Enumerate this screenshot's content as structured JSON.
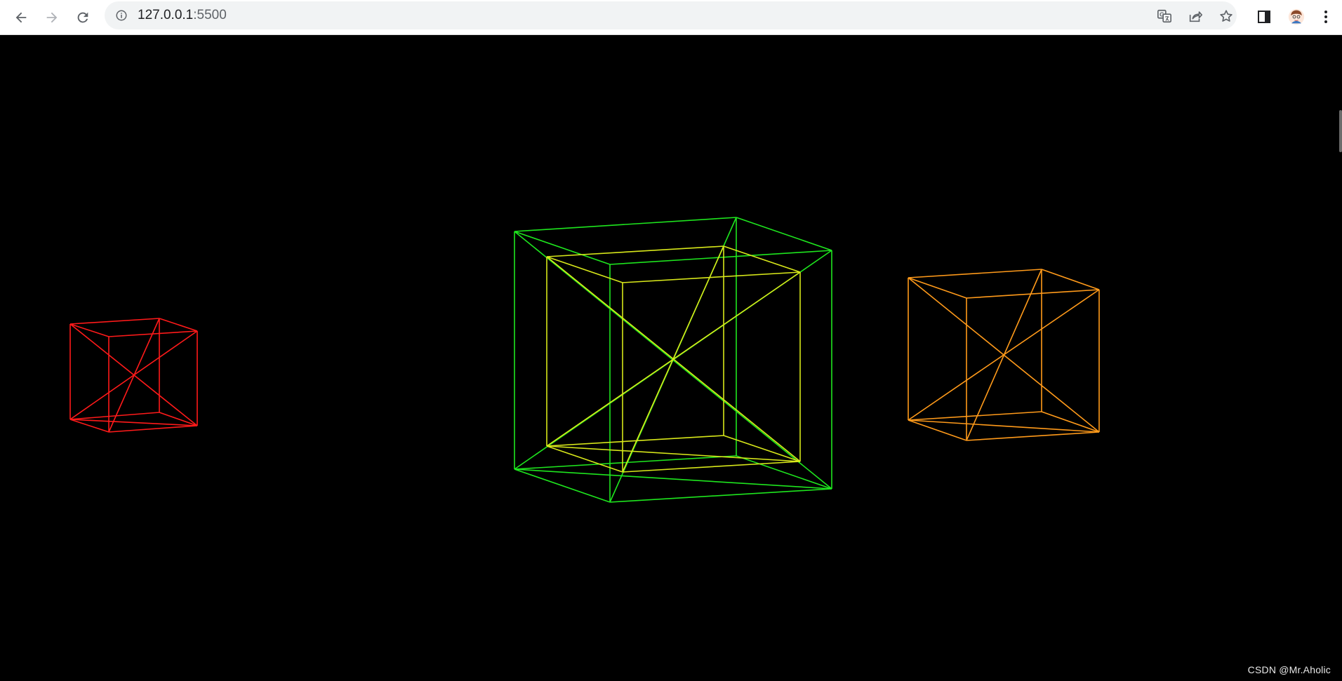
{
  "browser": {
    "url_host": "127.0.0.1",
    "url_port": ":5500",
    "icons": {
      "back": "arrow-left-icon",
      "forward": "arrow-right-icon",
      "reload": "reload-icon",
      "site_info": "info-icon",
      "translate": "translate-icon",
      "share": "share-icon",
      "bookmark": "star-icon",
      "side_panel": "side-panel-icon",
      "profile": "avatar-icon",
      "menu": "kebab-menu-icon"
    }
  },
  "scene": {
    "background": "#000000",
    "cubes": [
      {
        "name": "red-cube",
        "color": "#ff1a1a"
      },
      {
        "name": "green-cube",
        "color": "#1ee61e"
      },
      {
        "name": "yellow-cube",
        "color": "#d8e81a"
      },
      {
        "name": "orange-cube",
        "color": "#ff9a1a"
      }
    ]
  },
  "watermark": {
    "text": "CSDN @Mr.Aholic"
  }
}
